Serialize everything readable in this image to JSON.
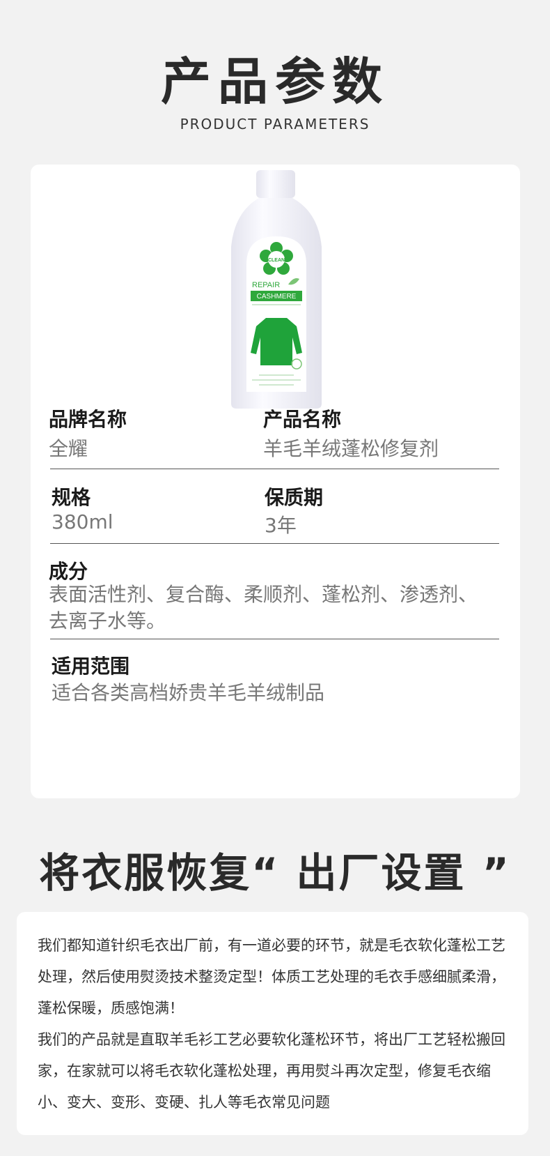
{
  "header": {
    "title": "产品参数",
    "subtitle": "PRODUCT PARAMETERS"
  },
  "product_image": {
    "logo_text": "CLEAN",
    "repair_text": "REPAIR",
    "cashmere_text": "CASHMERE",
    "colors": {
      "brand_green": "#2fa83c",
      "bottle": "#f7f7fb"
    }
  },
  "params": {
    "brand_label": "品牌名称",
    "brand_value": "全耀",
    "product_label": "产品名称",
    "product_value": "羊毛羊绒蓬松修复剂",
    "spec_label": "规格",
    "spec_value": "380ml",
    "shelf_label": "保质期",
    "shelf_value": "3年",
    "ingredients_label": "成分",
    "ingredients_value": "表面活性剂、复合酶、柔顺剂、蓬松剂、渗透剂、去离子水等。",
    "scope_label": "适用范围",
    "scope_value": "适合各类高档娇贵羊毛羊绒制品"
  },
  "slogan": "将衣服恢复“ 出厂设置 ”",
  "description": {
    "paragraph1": "我们都知道针织毛衣出厂前，有一道必要的环节，就是毛衣软化蓬松工艺处理，然后使用熨烫技术整烫定型！体质工艺处理的毛衣手感细腻柔滑，蓬松保暖，质感饱满！",
    "paragraph2": "我们的产品就是直取羊毛衫工艺必要软化蓬松环节，将出厂工艺轻松搬回家，在家就可以将毛衣软化蓬松处理，再用熨斗再次定型，修复毛衣缩小、变大、变形、变硬、扎人等毛衣常见问题"
  }
}
